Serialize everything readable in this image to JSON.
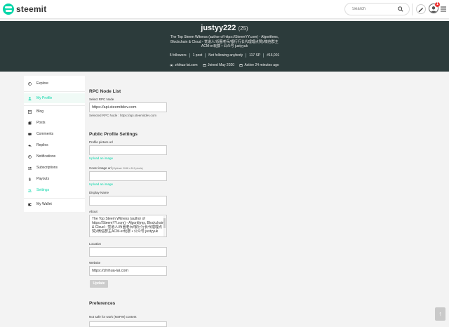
{
  "header": {
    "logo_text": "steemit",
    "search_placeholder": "Search",
    "notification_count": "1"
  },
  "profile": {
    "name": "justyy222",
    "reputation": "(25)",
    "bio": "The Top Steem Witness (author of https://SteemYY.com) - Algorithms, Blockchain & Cloud - 觉道人/币圈老兵/银行行长代理理点赞)/微信群主ACM-er玩群 • 公众号 justyyuk",
    "stats": [
      "5 followers",
      "1 post",
      "Not following anybody",
      "117 SP",
      "#16,001"
    ],
    "website": "zhihua-lai.com",
    "joined": "Joined May 2020",
    "active": "Active 24 minutes ago"
  },
  "sidebar": {
    "items": [
      {
        "label": "Explore",
        "icon": "compass-icon"
      },
      {
        "label": "My Profile",
        "icon": "user-icon"
      },
      {
        "label": "Blog",
        "icon": "blog-icon"
      },
      {
        "label": "Posts",
        "icon": "posts-icon"
      },
      {
        "label": "Comments",
        "icon": "comments-icon"
      },
      {
        "label": "Replies",
        "icon": "replies-icon"
      },
      {
        "label": "Notifications",
        "icon": "bell-icon"
      },
      {
        "label": "Subscriptions",
        "icon": "subscriptions-icon"
      },
      {
        "label": "Payouts",
        "icon": "dollar-icon"
      },
      {
        "label": "Settings",
        "icon": "settings-icon"
      },
      {
        "label": "My Wallet",
        "icon": "wallet-icon"
      }
    ]
  },
  "settings": {
    "rpc_title": "RPC Node List",
    "rpc_label": "Select RPC Node",
    "rpc_value": "https://api.steemitdev.com",
    "rpc_selected": "Selected RPC Node : https://api.steemitdev.com",
    "public_title": "Public Profile Settings",
    "profile_pic_label": "Profile picture url",
    "upload_image": "Upload an image",
    "cover_label": "Cover image url",
    "cover_hint": "(Optimal: 2048 x 512 pixels)",
    "upload_image_2": "Upload an image",
    "display_name_label": "Display Name",
    "about_label": "About",
    "about_value": "The Top Steem Witness (author of https://SteemYY.com) - Algorithms, Blockchain & Cloud - 觉道人/币圈老兵/银行行长代理理点赞)/微信群主ACM-er玩群 • 公众号 justyyuk",
    "location_label": "Location",
    "website_label": "Website",
    "website_value": "https://zhihua-lai.com",
    "update_button": "Update",
    "preferences_title": "Preferences",
    "nsfw_label": "Not safe for work (NSFW) content"
  },
  "colors": {
    "accent": "#06d6a9",
    "banner": "#2c3b3b"
  }
}
